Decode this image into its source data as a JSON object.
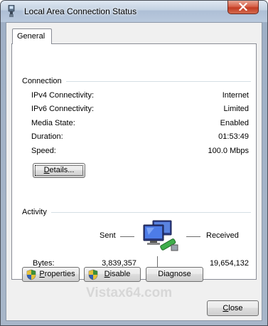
{
  "window": {
    "title": "Local Area Connection Status"
  },
  "tabs": [
    {
      "label": "General"
    }
  ],
  "connection": {
    "group_label": "Connection",
    "rows": [
      {
        "label": "IPv4 Connectivity:",
        "value": "Internet"
      },
      {
        "label": "IPv6 Connectivity:",
        "value": "Limited"
      },
      {
        "label": "Media State:",
        "value": "Enabled"
      },
      {
        "label": "Duration:",
        "value": "01:53:49"
      },
      {
        "label": "Speed:",
        "value": "100.0 Mbps"
      }
    ],
    "details_button": {
      "accel": "D",
      "rest": "etails..."
    }
  },
  "activity": {
    "group_label": "Activity",
    "sent_label": "Sent",
    "received_label": "Received",
    "bytes_label": "Bytes:",
    "bytes_sent": "3,839,357",
    "bytes_received": "19,654,132"
  },
  "buttons": {
    "properties": {
      "accel": "P",
      "rest": "roperties"
    },
    "disable": {
      "accel": "D",
      "rest": "isable"
    },
    "diagnose": {
      "pre": "Dia",
      "accel": "g",
      "rest": "nose"
    },
    "close": {
      "accel": "C",
      "rest": "lose"
    }
  },
  "watermark": "Vistax64.com",
  "icons": {
    "title": "network-adapter-icon",
    "close": "close-x-icon",
    "network": "network-computers-icon",
    "shield": "uac-shield-icon"
  }
}
